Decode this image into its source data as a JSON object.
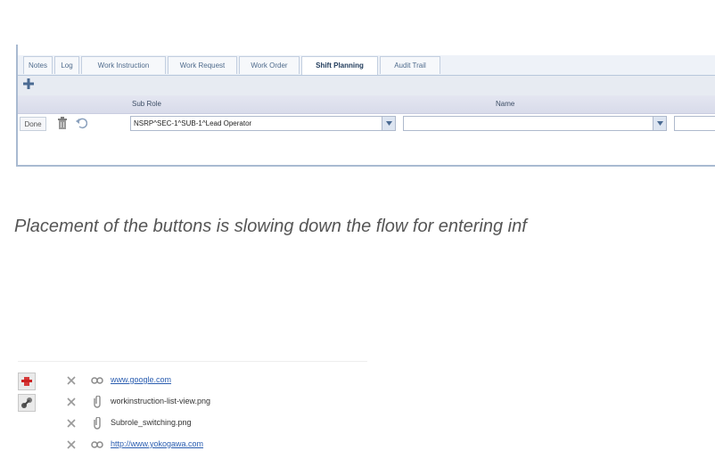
{
  "tabs": [
    {
      "label": "Notes"
    },
    {
      "label": "Log"
    },
    {
      "label": "Work Instruction"
    },
    {
      "label": "Work Request"
    },
    {
      "label": "Work Order"
    },
    {
      "label": "Shift Planning",
      "active": true
    },
    {
      "label": "Audit Trail"
    }
  ],
  "grid": {
    "headers": {
      "sub_role": "Sub Role",
      "name": "Name"
    },
    "row": {
      "done_label": "Done",
      "sub_role_value": "NSRP^SEC-1^SUB-1^Lead Operator",
      "name_value": ""
    }
  },
  "caption": "Placement of the buttons is slowing down the flow for entering inf",
  "attachments": [
    {
      "type": "link",
      "text": "www.google.com",
      "thumb": "red-thumbnail",
      "icon": "link-icon"
    },
    {
      "type": "file",
      "text": "workinstruction-list-view.png",
      "thumb": "image-thumbnail",
      "icon": "paperclip-icon"
    },
    {
      "type": "file",
      "text": "Subrole_switching.png",
      "thumb": null,
      "icon": "paperclip-icon"
    },
    {
      "type": "link",
      "text": "http://www.yokogawa.com",
      "thumb": null,
      "icon": "link-icon"
    }
  ],
  "colors": {
    "link": "#2a5db0",
    "tab_text": "#4f6b8c",
    "header_bg": "#e4e6f1",
    "panel_border": "#a9bad1"
  }
}
